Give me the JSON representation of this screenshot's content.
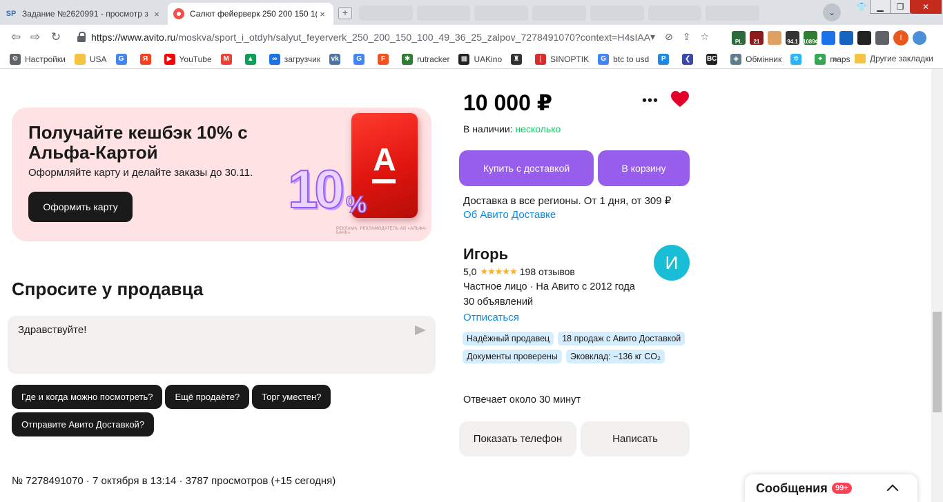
{
  "browser": {
    "tabs": [
      {
        "title": "Задание №2620991 - просмотр з",
        "favicon": "SP",
        "active": false
      },
      {
        "title": "Салют фейерверк 250 200 150 1(",
        "favicon": "avito",
        "active": true
      }
    ],
    "close_glyph": "×",
    "new_tab_glyph": "+",
    "url_host": "https://www.avito.ru",
    "url_path": "/moskva/sport_i_otdyh/salyut_feyerverk_250_200_150_100_49_36_25_zalpov_7278491070?context=H4sIAAA...",
    "profile_initial": "I",
    "extension_badges": [
      "PL",
      "21",
      "94.1",
      "1089¢"
    ],
    "bookmarks": [
      {
        "label": "Настройки",
        "icon": "gear-icon",
        "color": "#5f6368"
      },
      {
        "label": "USA",
        "icon": "folder-icon",
        "color": "#f6c343"
      },
      {
        "label": "",
        "icon": "google-icon",
        "color": "#4285f4"
      },
      {
        "label": "",
        "icon": "yandex-icon",
        "color": "#fc3f1d"
      },
      {
        "label": "YouTube",
        "icon": "youtube-icon",
        "color": "#ff0000"
      },
      {
        "label": "",
        "icon": "gmail-icon",
        "color": "#ea4335"
      },
      {
        "label": "",
        "icon": "drive-icon",
        "color": "#0f9d58"
      },
      {
        "label": "загрузчик",
        "icon": "loader-icon",
        "color": "#1a73e8"
      },
      {
        "label": "",
        "icon": "vk-icon",
        "color": "#4c75a3"
      },
      {
        "label": "",
        "icon": "translate-icon",
        "color": "#4285f4"
      },
      {
        "label": "",
        "icon": "f-icon",
        "color": "#f4511e"
      },
      {
        "label": "rutracker",
        "icon": "rutracker-icon",
        "color": "#2e7d32"
      },
      {
        "label": "UAKino",
        "icon": "uakino-icon",
        "color": "#222222"
      },
      {
        "label": "",
        "icon": "bottle-icon",
        "color": "#333333"
      },
      {
        "label": "SINOPTIK",
        "icon": "thermometer-icon",
        "color": "#d32f2f"
      },
      {
        "label": "btc to usd",
        "icon": "google-icon",
        "color": "#4285f4"
      },
      {
        "label": "",
        "icon": "p-icon",
        "color": "#1e88e5"
      },
      {
        "label": "",
        "icon": "arrow-icon",
        "color": "#3949ab"
      },
      {
        "label": "",
        "icon": "bc-icon",
        "color": "#222222"
      },
      {
        "label": "Обмінник",
        "icon": "exchange-icon",
        "color": "#607d8b"
      },
      {
        "label": "",
        "icon": "star-icon",
        "color": "#29b6f6"
      },
      {
        "label": "maps",
        "icon": "maps-icon",
        "color": "#34a853"
      }
    ],
    "bookmarks_more": "»",
    "other_bookmarks": "Другие закладки"
  },
  "promo": {
    "title": "Получайте кешбэк 10% с Альфа-Картой",
    "subtitle": "Оформляйте карту и делайте заказы до 30.11.",
    "button": "Оформить карту",
    "card_letter": "А",
    "big_number": "10",
    "big_percent": "%",
    "legal": "РЕКЛАМА. РЕКЛАМОДАТЕЛЬ АО «АЛЬФА-БАНК»"
  },
  "ask": {
    "title": "Спросите у продавца",
    "message": "Здравствуйте!",
    "quick_questions": [
      "Где и когда можно посмотреть?",
      "Ещё продаёте?",
      "Торг уместен?",
      "Отправите Авито Доставкой?"
    ]
  },
  "item_meta": "№ 7278491070 · 7 октября в 13:14 · 3787 просмотров (+15 сегодня)",
  "listing": {
    "price": "10 000 ₽",
    "more_glyph": "•••",
    "availability_label": "В наличии:",
    "availability_value": "несколько",
    "buy_delivery": "Купить с доставкой",
    "add_to_cart": "В корзину",
    "delivery_text": "Доставка в все регионы. От 1 дня, от 309 ₽",
    "delivery_link": "Об Авито Доставке",
    "favorited": true
  },
  "seller": {
    "name": "Игорь",
    "rating": "5,0",
    "stars": "★★★★★",
    "reviews": "198 отзывов",
    "type": "Частное лицо · На Авито с 2012 года",
    "ads": "30 объявлений",
    "unsubscribe": "Отписаться",
    "avatar_initial": "И",
    "badges": [
      "Надёжный продавец",
      "18 продаж с Авито Доставкой",
      "Документы проверены",
      "Эковклад: −136 кг CO₂"
    ],
    "reply_time": "Отвечает около 30 минут",
    "show_phone": "Показать телефон",
    "write": "Написать"
  },
  "messages": {
    "label": "Сообщения",
    "count": "99+"
  },
  "colors": {
    "accent_purple": "#965eeb",
    "link_blue": "#0a8ae2",
    "green": "#02d15c",
    "heart_red": "#e3002a",
    "avatar_teal": "#19bdd6",
    "promo_bg": "#ffe2e3"
  }
}
